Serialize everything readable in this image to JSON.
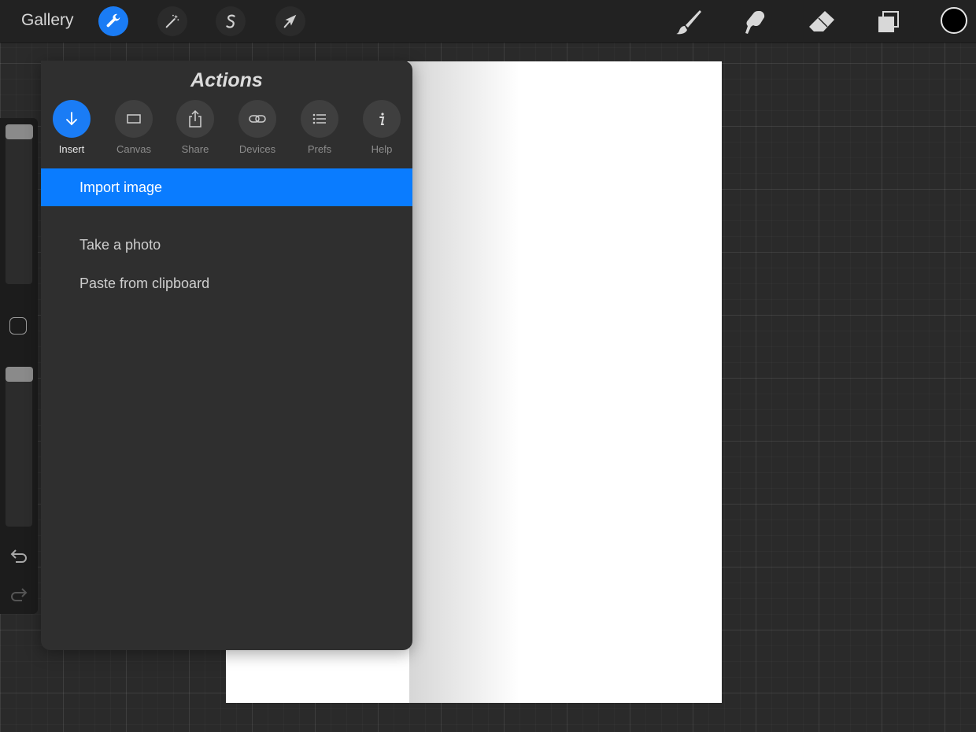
{
  "topbar": {
    "gallery_label": "Gallery",
    "tools": [
      {
        "name": "actions",
        "icon": "wrench-icon",
        "active": true
      },
      {
        "name": "adjustments",
        "icon": "magic-wand-icon",
        "active": false
      },
      {
        "name": "selection",
        "icon": "selection-s-icon",
        "active": false
      },
      {
        "name": "transform",
        "icon": "arrow-cursor-icon",
        "active": false
      }
    ],
    "right_tools": [
      "brush-icon",
      "smudge-icon",
      "eraser-icon",
      "layers-icon"
    ],
    "color_swatch": "#000000"
  },
  "panel": {
    "title": "Actions",
    "tabs": [
      {
        "label": "Insert",
        "icon": "arrow-down-icon",
        "active": true
      },
      {
        "label": "Canvas",
        "icon": "rectangle-icon",
        "active": false
      },
      {
        "label": "Share",
        "icon": "share-icon",
        "active": false
      },
      {
        "label": "Devices",
        "icon": "link-icon",
        "active": false
      },
      {
        "label": "Prefs",
        "icon": "list-icon",
        "active": false
      },
      {
        "label": "Help",
        "icon": "info-icon",
        "active": false
      }
    ],
    "items": [
      {
        "label": "Import image",
        "selected": true
      },
      {
        "label": "Take a photo",
        "selected": false
      },
      {
        "label": "Paste from clipboard",
        "selected": false
      }
    ]
  },
  "colors": {
    "accent": "#1a7cf5",
    "selection": "#0a7cff",
    "panel_bg": "#2f2f2f",
    "canvas": "#ffffff"
  }
}
